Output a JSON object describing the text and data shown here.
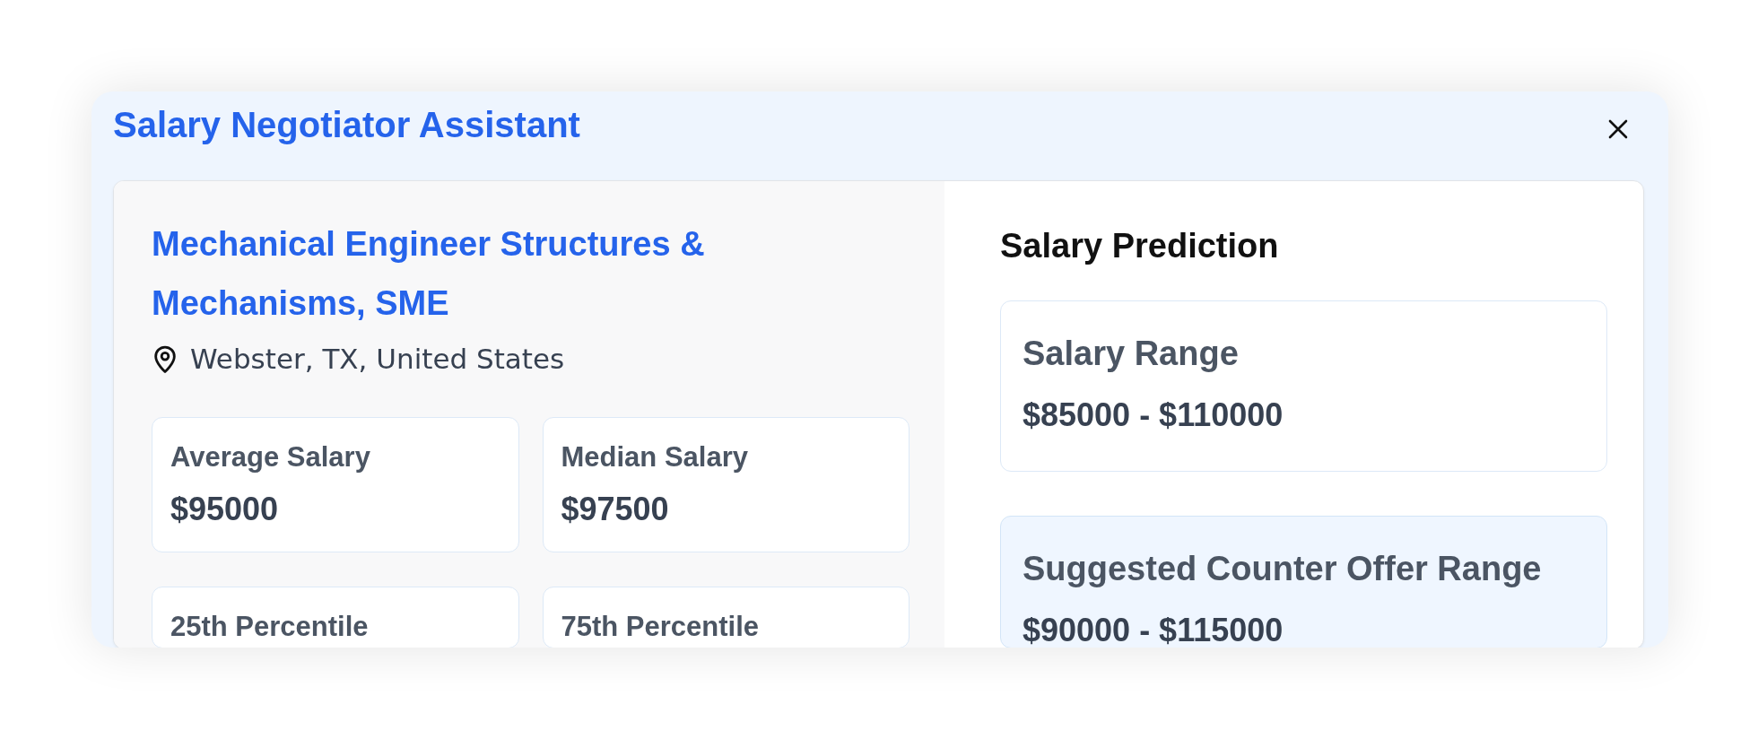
{
  "modal": {
    "title": "Salary Negotiator Assistant"
  },
  "job": {
    "title": "Mechanical Engineer Structures & Mechanisms, SME",
    "location": "Webster, TX, United States",
    "stats": [
      {
        "label": "Average Salary",
        "value": "$95000"
      },
      {
        "label": "Median Salary",
        "value": "$97500"
      },
      {
        "label": "25th Percentile"
      },
      {
        "label": "75th Percentile"
      }
    ]
  },
  "prediction": {
    "title": "Salary Prediction",
    "ranges": [
      {
        "kind": "plain",
        "label": "Salary Range",
        "value": "$85000 - $110000"
      },
      {
        "kind": "highlight",
        "label": "Suggested Counter Offer Range",
        "value": "$90000 - $115000"
      }
    ]
  }
}
